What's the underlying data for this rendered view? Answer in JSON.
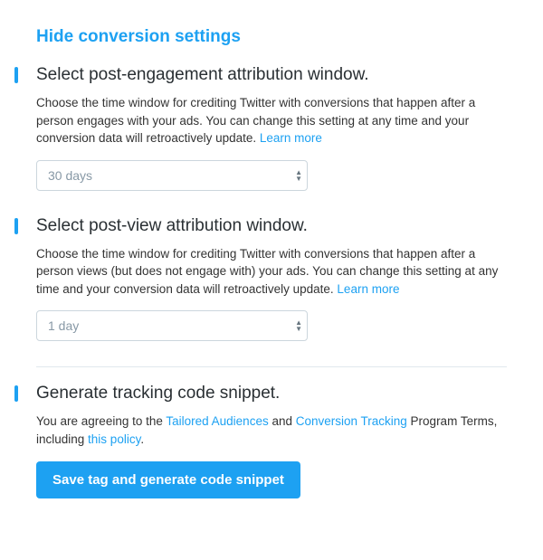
{
  "header": {
    "toggle_label": "Hide conversion settings"
  },
  "engagement": {
    "heading": "Select post-engagement attribution window.",
    "desc_prefix": "Choose the time window for crediting Twitter with conversions that happen after a person engages with your ads. You can change this setting at any time and your conversion data will retroactively update. ",
    "learn_more": "Learn more",
    "selected": "30 days"
  },
  "view": {
    "heading": "Select post-view attribution window.",
    "desc_prefix": "Choose the time window for crediting Twitter with conversions that happen after a person views (but does not engage with) your ads. You can change this setting at any time and your conversion data will retroactively update. ",
    "learn_more": "Learn more",
    "selected": "1 day"
  },
  "generate": {
    "heading": "Generate tracking code snippet.",
    "agree_prefix": "You are agreeing to the ",
    "tailored": "Tailored Audiences",
    "and": " and ",
    "tracking": "Conversion Tracking",
    "program_terms": " Program Terms, including ",
    "policy": "this policy",
    "period": ".",
    "button": "Save tag and generate code snippet"
  }
}
